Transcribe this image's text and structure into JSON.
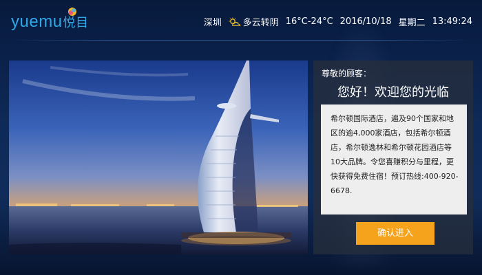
{
  "header": {
    "logo_text": "yuemu",
    "logo_cn": "悦目",
    "city": "深圳",
    "weather_icon": "partly-cloudy-icon",
    "weather": "多云转阴",
    "temperature": "16°C-24°C",
    "date": "2016/10/18",
    "weekday": "星期二",
    "time": "13:49:24"
  },
  "hero": {
    "image": "burj-al-arab-hotel-photo"
  },
  "panel": {
    "greeting_small": "尊敬的顾客：",
    "greeting_big": "您好！欢迎您的光临",
    "info_text": "希尔顿国际酒店，遍及90个国家和地区的逾4,000家酒店，包括希尔顿酒店，希尔顿逸林和希尔顿花园酒店等10大品牌。令您喜赚积分与里程，更快获得免费住宿！预订热线:400-920-6678.",
    "enter_button": "确认进入"
  },
  "colors": {
    "brand": "#2ea8e6",
    "button": "#f5a31c",
    "background": "#0e2a58"
  }
}
